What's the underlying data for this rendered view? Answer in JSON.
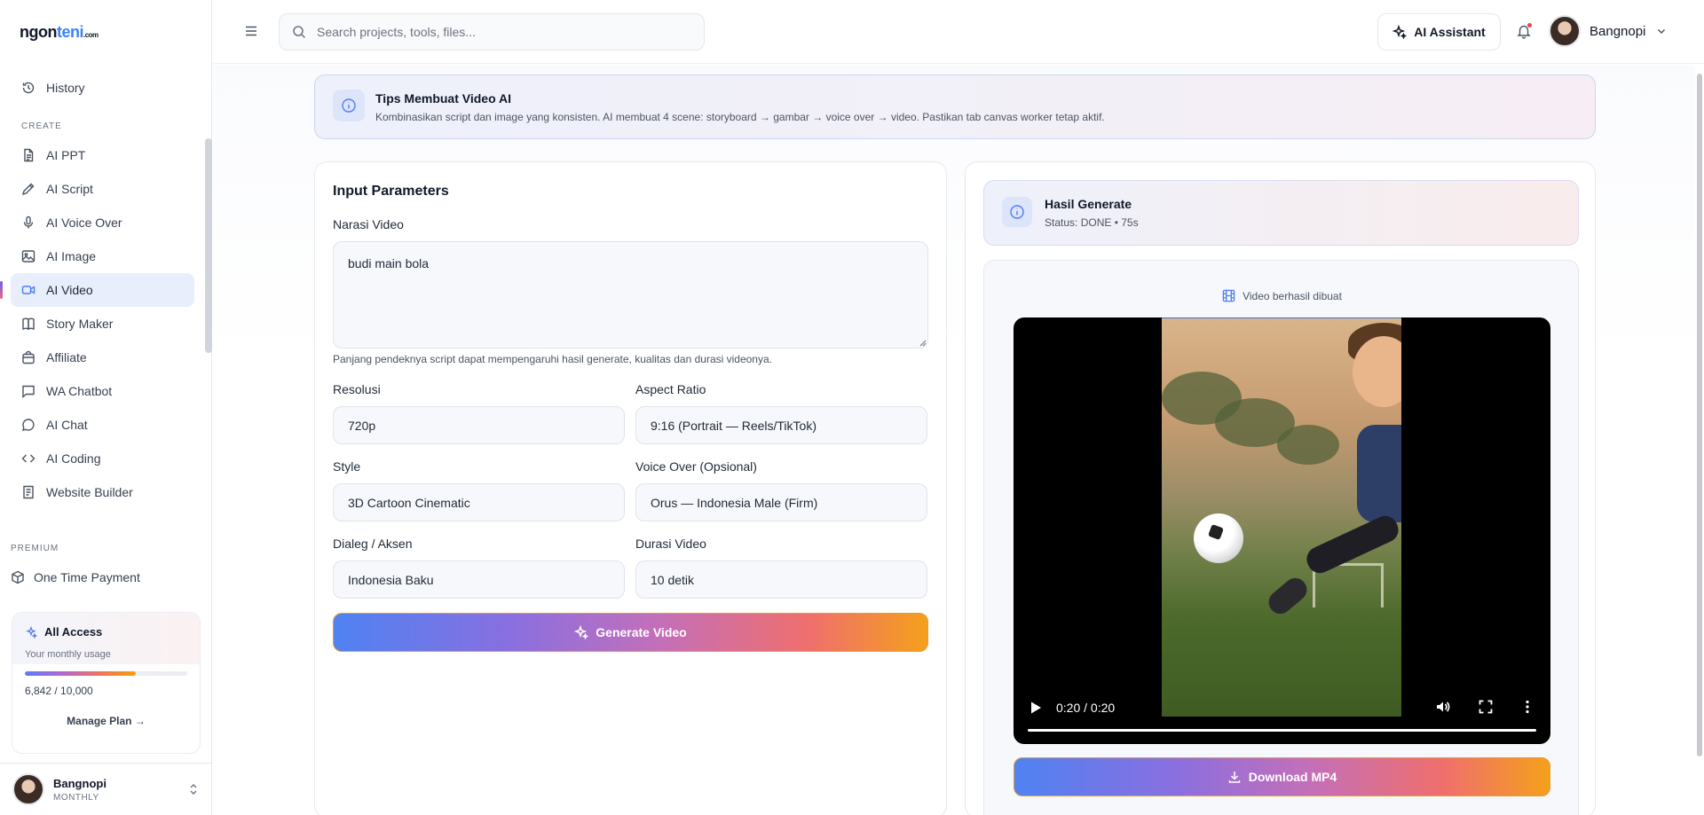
{
  "brand": {
    "logo_main": "ngon",
    "logo_accent": "teni",
    "logo_domain": ".com"
  },
  "sidebar": {
    "history": "History",
    "create_label": "CREATE",
    "items": [
      {
        "label": "AI PPT",
        "icon": "document-icon"
      },
      {
        "label": "AI Script",
        "icon": "pen-icon"
      },
      {
        "label": "AI Voice Over",
        "icon": "microphone-icon"
      },
      {
        "label": "AI Image",
        "icon": "image-icon"
      },
      {
        "label": "AI Video",
        "icon": "video-camera-icon",
        "active": true
      },
      {
        "label": "Story Maker",
        "icon": "book-icon"
      },
      {
        "label": "Affiliate",
        "icon": "shopping-bag-icon"
      },
      {
        "label": "WA Chatbot",
        "icon": "chat-square-icon"
      },
      {
        "label": "AI Chat",
        "icon": "chat-bubble-icon"
      },
      {
        "label": "AI Coding",
        "icon": "code-icon"
      },
      {
        "label": "Website Builder",
        "icon": "page-icon"
      }
    ],
    "premium_label": "PREMIUM",
    "one_time_payment": "One Time Payment",
    "access_card": {
      "title": "All Access",
      "subtitle": "Your monthly usage",
      "usage_text": "6,842 / 10,000",
      "usage_fraction": 0.6842,
      "manage_plan": "Manage Plan →"
    },
    "user": {
      "name": "Bangnopi",
      "plan": "MONTHLY"
    }
  },
  "topbar": {
    "search_placeholder": "Search projects, tools, files...",
    "ai_assistant": "AI Assistant",
    "user_name": "Bangnopi"
  },
  "tips": {
    "title": "Tips Membuat Video AI",
    "text": "Kombinasikan script dan image yang konsisten. AI membuat 4 scene: storyboard → gambar → voice over → video. Pastikan tab canvas worker tetap aktif."
  },
  "form": {
    "title": "Input Parameters",
    "narasi_label": "Narasi Video",
    "narasi_value": "budi main bola",
    "hint": "Panjang pendeknya script dapat mempengaruhi hasil generate, kualitas dan durasi videonya.",
    "resolusi_label": "Resolusi",
    "resolusi_value": "720p",
    "aspect_label": "Aspect Ratio",
    "aspect_value": "9:16 (Portrait — Reels/TikTok)",
    "style_label": "Style",
    "style_value": "3D Cartoon Cinematic",
    "voice_label": "Voice Over (Opsional)",
    "voice_value": "Orus — Indonesia Male (Firm)",
    "dialeg_label": "Dialeg / Aksen",
    "dialeg_value": "Indonesia Baku",
    "durasi_label": "Durasi Video",
    "durasi_value": "10 detik",
    "generate_button": "Generate Video"
  },
  "result": {
    "title": "Hasil Generate",
    "status": "Status: DONE • 75s",
    "caption": "Video berhasil dibuat",
    "time": "0:20 / 0:20",
    "playback_fraction": 1.0,
    "download_button": "Download MP4"
  },
  "colors": {
    "accent": "#4f7df3",
    "gradient_start": "#4f82f2",
    "gradient_end": "#f4a01c",
    "notification_dot": "#ef4444"
  }
}
